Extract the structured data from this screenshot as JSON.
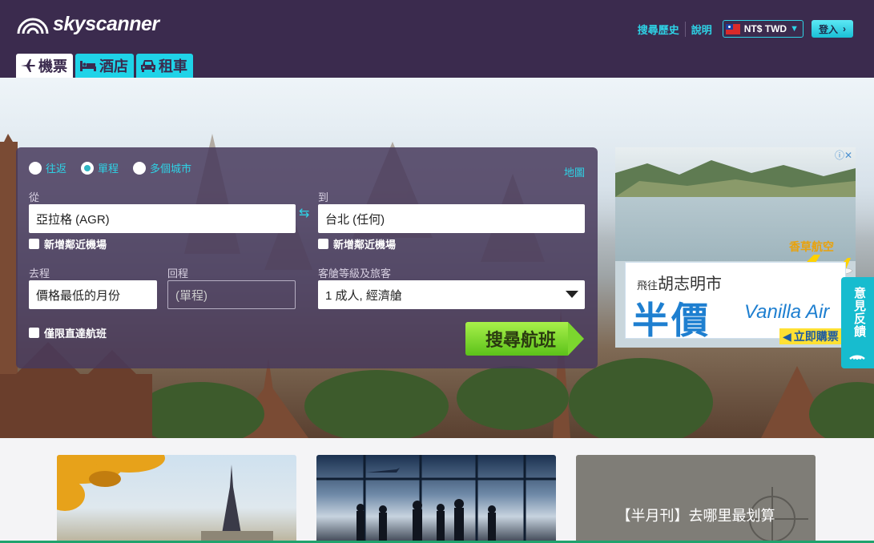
{
  "header": {
    "logo_text": "skyscanner",
    "links": [
      "搜尋歷史",
      "說明"
    ],
    "currency": "NT$ TWD",
    "login": "登入"
  },
  "tabs": [
    {
      "label": "機票",
      "icon": "plane-icon",
      "active": true
    },
    {
      "label": "酒店",
      "icon": "bed-icon",
      "active": false
    },
    {
      "label": "租車",
      "icon": "car-icon",
      "active": false
    }
  ],
  "search": {
    "trip_types": [
      {
        "label": "往返",
        "selected": false
      },
      {
        "label": "單程",
        "selected": true
      },
      {
        "label": "多個城市",
        "selected": false
      }
    ],
    "map_link": "地圖",
    "from_label": "從",
    "from_value": "亞拉格 (AGR)",
    "to_label": "到",
    "to_value": "台北 (任何)",
    "nearby_airports": "新增鄰近機場",
    "depart_label": "去程",
    "depart_value": "價格最低的月份",
    "return_label": "回程",
    "return_value": "(單程)",
    "cabin_label": "客艙等級及旅客",
    "cabin_value": "1 成人, 經濟艙",
    "direct_only": "僅限直達航班",
    "search_button": "搜尋航班"
  },
  "ad": {
    "brand_cn": "香草航空",
    "route_prefix": "飛往",
    "route_city": "胡志明市",
    "headline": "半價",
    "brand_en": "Vanilla Air",
    "cta": "立即購票",
    "info": "ⓘ✕"
  },
  "feedback": "意見反饋",
  "cards": [
    {
      "title": ""
    },
    {
      "title": ""
    },
    {
      "title": "【半月刊】去哪里最划算"
    }
  ],
  "colors": {
    "header_bg": "#3b2b4e",
    "accent": "#2ed3e6",
    "search_green": "#7cd62e"
  }
}
